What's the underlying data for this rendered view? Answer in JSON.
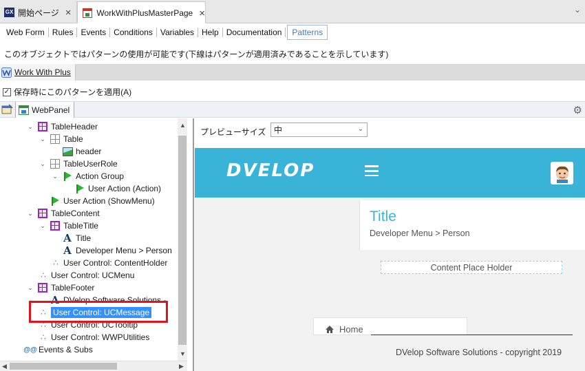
{
  "doc_tabs": [
    {
      "label": "開始ページ",
      "icon": "gx-icon",
      "active": false
    },
    {
      "label": "WorkWithPlusMasterPage",
      "icon": "webpanel-icon",
      "active": true
    }
  ],
  "pattern_tabs": [
    "Web Form",
    "Rules",
    "Events",
    "Conditions",
    "Variables",
    "Help",
    "Documentation",
    "Patterns"
  ],
  "active_pattern_tab": "Patterns",
  "message": "このオブジェクトではパターンの使用が可能です(下線はパターンが適用済みであることを示しています)",
  "pattern_name": "Work With Plus",
  "apply_on_save": {
    "label": "保存時にこのパターンを適用(A)",
    "checked": true
  },
  "instance_tab": "WebPanel",
  "tree": [
    {
      "label": "TableHeader",
      "icon": "table-purple-icon"
    },
    {
      "label": "Table",
      "icon": "table-gray-icon"
    },
    {
      "label": "header",
      "icon": "image-icon"
    },
    {
      "label": "TableUserRole",
      "icon": "table-gray-icon"
    },
    {
      "label": "Action Group",
      "icon": "flag-icon"
    },
    {
      "label": "User Action (Action)",
      "icon": "flag-icon"
    },
    {
      "label": "User Action (ShowMenu)",
      "icon": "flag-icon"
    },
    {
      "label": "TableContent",
      "icon": "table-purple-icon"
    },
    {
      "label": "TableTitle",
      "icon": "table-purple-icon"
    },
    {
      "label": "Title",
      "icon": "text-icon"
    },
    {
      "label": "Developer Menu > Person",
      "icon": "text-icon"
    },
    {
      "label": "User Control: ContentHolder",
      "icon": "user-control-icon"
    },
    {
      "label": "User Control: UCMenu",
      "icon": "user-control-icon"
    },
    {
      "label": "TableFooter",
      "icon": "table-purple-icon"
    },
    {
      "label": "DVelop Software Solutions -",
      "icon": "text-icon"
    },
    {
      "label": "User Control: UCMessage",
      "icon": "user-control-icon",
      "selected": true
    },
    {
      "label": "User Control: UCTooltip",
      "icon": "user-control-icon"
    },
    {
      "label": "User Control: WWPUtilities",
      "icon": "user-control-icon"
    },
    {
      "label": "Events & Subs",
      "icon": "events-icon"
    }
  ],
  "preview": {
    "size_label": "プレビューサイズ",
    "size_value": "中",
    "logo": "DVELOP",
    "header_color": "#3ab3d8",
    "title": "Title",
    "breadcrumb": "Developer Menu > Person",
    "content_placeholder": "Content Place Holder",
    "home": "Home",
    "footer": "DVelop Software Solutions - copyright 2019"
  }
}
